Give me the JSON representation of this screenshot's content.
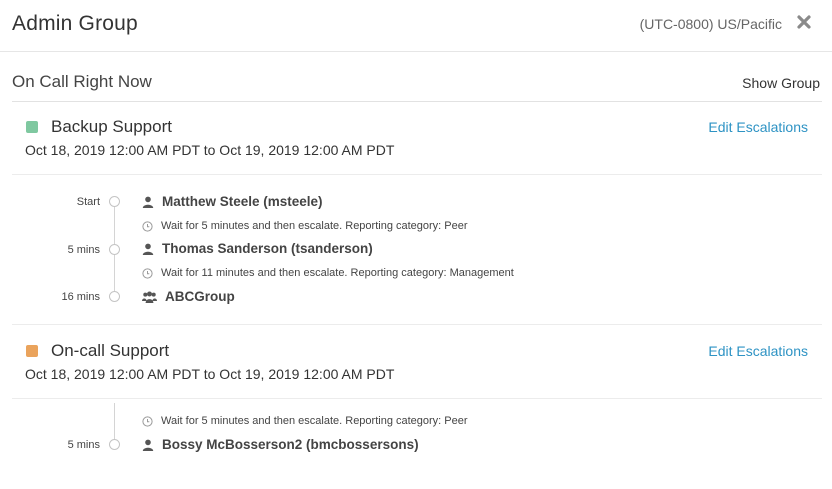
{
  "header": {
    "title": "Admin Group",
    "timezone": "(UTC-0800) US/Pacific",
    "close_icon": "close-icon"
  },
  "subheader": {
    "label": "On Call Right Now",
    "show_group": "Show Group"
  },
  "schedules": [
    {
      "name": "Backup Support",
      "color": "#7fc8a0",
      "range": "Oct 18, 2019 12:00 AM PDT to Oct 19, 2019 12:00 AM PDT",
      "edit_label": "Edit Escalations",
      "steps": [
        {
          "label": "Start",
          "name": "Matthew Steele (msteele)",
          "icon": "user-icon"
        },
        {
          "wait": "Wait for 5 minutes and then escalate. Reporting category: Peer"
        },
        {
          "label": "5 mins",
          "name": "Thomas Sanderson (tsanderson)",
          "icon": "user-icon"
        },
        {
          "wait": "Wait for 11 minutes and then escalate. Reporting category: Management"
        },
        {
          "label": "16 mins",
          "name": "ABCGroup",
          "icon": "group-icon"
        }
      ]
    },
    {
      "name": "On-call Support",
      "color": "#eaa35c",
      "range": "Oct 18, 2019 12:00 AM PDT to Oct 19, 2019 12:00 AM PDT",
      "edit_label": "Edit Escalations",
      "steps": [
        {
          "wait": "Wait for 5 minutes and then escalate. Reporting category: Peer"
        },
        {
          "label": "5 mins",
          "name": "Bossy McBosserson2 (bmcbossersons)",
          "icon": "user-icon"
        }
      ]
    }
  ]
}
